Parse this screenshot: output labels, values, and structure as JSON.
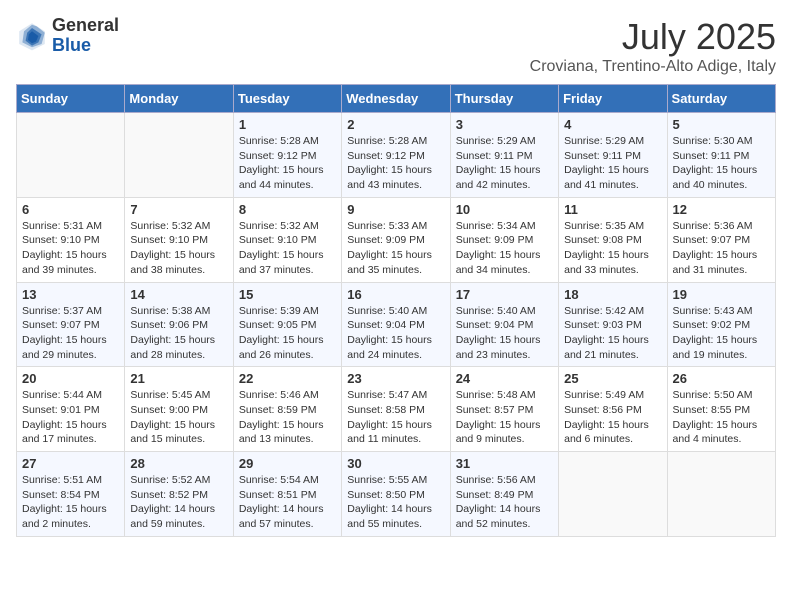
{
  "header": {
    "logo_general": "General",
    "logo_blue": "Blue",
    "month_title": "July 2025",
    "location": "Croviana, Trentino-Alto Adige, Italy"
  },
  "calendar": {
    "days_of_week": [
      "Sunday",
      "Monday",
      "Tuesday",
      "Wednesday",
      "Thursday",
      "Friday",
      "Saturday"
    ],
    "weeks": [
      [
        {
          "day": "",
          "info": ""
        },
        {
          "day": "",
          "info": ""
        },
        {
          "day": "1",
          "info": "Sunrise: 5:28 AM\nSunset: 9:12 PM\nDaylight: 15 hours and 44 minutes."
        },
        {
          "day": "2",
          "info": "Sunrise: 5:28 AM\nSunset: 9:12 PM\nDaylight: 15 hours and 43 minutes."
        },
        {
          "day": "3",
          "info": "Sunrise: 5:29 AM\nSunset: 9:11 PM\nDaylight: 15 hours and 42 minutes."
        },
        {
          "day": "4",
          "info": "Sunrise: 5:29 AM\nSunset: 9:11 PM\nDaylight: 15 hours and 41 minutes."
        },
        {
          "day": "5",
          "info": "Sunrise: 5:30 AM\nSunset: 9:11 PM\nDaylight: 15 hours and 40 minutes."
        }
      ],
      [
        {
          "day": "6",
          "info": "Sunrise: 5:31 AM\nSunset: 9:10 PM\nDaylight: 15 hours and 39 minutes."
        },
        {
          "day": "7",
          "info": "Sunrise: 5:32 AM\nSunset: 9:10 PM\nDaylight: 15 hours and 38 minutes."
        },
        {
          "day": "8",
          "info": "Sunrise: 5:32 AM\nSunset: 9:10 PM\nDaylight: 15 hours and 37 minutes."
        },
        {
          "day": "9",
          "info": "Sunrise: 5:33 AM\nSunset: 9:09 PM\nDaylight: 15 hours and 35 minutes."
        },
        {
          "day": "10",
          "info": "Sunrise: 5:34 AM\nSunset: 9:09 PM\nDaylight: 15 hours and 34 minutes."
        },
        {
          "day": "11",
          "info": "Sunrise: 5:35 AM\nSunset: 9:08 PM\nDaylight: 15 hours and 33 minutes."
        },
        {
          "day": "12",
          "info": "Sunrise: 5:36 AM\nSunset: 9:07 PM\nDaylight: 15 hours and 31 minutes."
        }
      ],
      [
        {
          "day": "13",
          "info": "Sunrise: 5:37 AM\nSunset: 9:07 PM\nDaylight: 15 hours and 29 minutes."
        },
        {
          "day": "14",
          "info": "Sunrise: 5:38 AM\nSunset: 9:06 PM\nDaylight: 15 hours and 28 minutes."
        },
        {
          "day": "15",
          "info": "Sunrise: 5:39 AM\nSunset: 9:05 PM\nDaylight: 15 hours and 26 minutes."
        },
        {
          "day": "16",
          "info": "Sunrise: 5:40 AM\nSunset: 9:04 PM\nDaylight: 15 hours and 24 minutes."
        },
        {
          "day": "17",
          "info": "Sunrise: 5:40 AM\nSunset: 9:04 PM\nDaylight: 15 hours and 23 minutes."
        },
        {
          "day": "18",
          "info": "Sunrise: 5:42 AM\nSunset: 9:03 PM\nDaylight: 15 hours and 21 minutes."
        },
        {
          "day": "19",
          "info": "Sunrise: 5:43 AM\nSunset: 9:02 PM\nDaylight: 15 hours and 19 minutes."
        }
      ],
      [
        {
          "day": "20",
          "info": "Sunrise: 5:44 AM\nSunset: 9:01 PM\nDaylight: 15 hours and 17 minutes."
        },
        {
          "day": "21",
          "info": "Sunrise: 5:45 AM\nSunset: 9:00 PM\nDaylight: 15 hours and 15 minutes."
        },
        {
          "day": "22",
          "info": "Sunrise: 5:46 AM\nSunset: 8:59 PM\nDaylight: 15 hours and 13 minutes."
        },
        {
          "day": "23",
          "info": "Sunrise: 5:47 AM\nSunset: 8:58 PM\nDaylight: 15 hours and 11 minutes."
        },
        {
          "day": "24",
          "info": "Sunrise: 5:48 AM\nSunset: 8:57 PM\nDaylight: 15 hours and 9 minutes."
        },
        {
          "day": "25",
          "info": "Sunrise: 5:49 AM\nSunset: 8:56 PM\nDaylight: 15 hours and 6 minutes."
        },
        {
          "day": "26",
          "info": "Sunrise: 5:50 AM\nSunset: 8:55 PM\nDaylight: 15 hours and 4 minutes."
        }
      ],
      [
        {
          "day": "27",
          "info": "Sunrise: 5:51 AM\nSunset: 8:54 PM\nDaylight: 15 hours and 2 minutes."
        },
        {
          "day": "28",
          "info": "Sunrise: 5:52 AM\nSunset: 8:52 PM\nDaylight: 14 hours and 59 minutes."
        },
        {
          "day": "29",
          "info": "Sunrise: 5:54 AM\nSunset: 8:51 PM\nDaylight: 14 hours and 57 minutes."
        },
        {
          "day": "30",
          "info": "Sunrise: 5:55 AM\nSunset: 8:50 PM\nDaylight: 14 hours and 55 minutes."
        },
        {
          "day": "31",
          "info": "Sunrise: 5:56 AM\nSunset: 8:49 PM\nDaylight: 14 hours and 52 minutes."
        },
        {
          "day": "",
          "info": ""
        },
        {
          "day": "",
          "info": ""
        }
      ]
    ]
  }
}
